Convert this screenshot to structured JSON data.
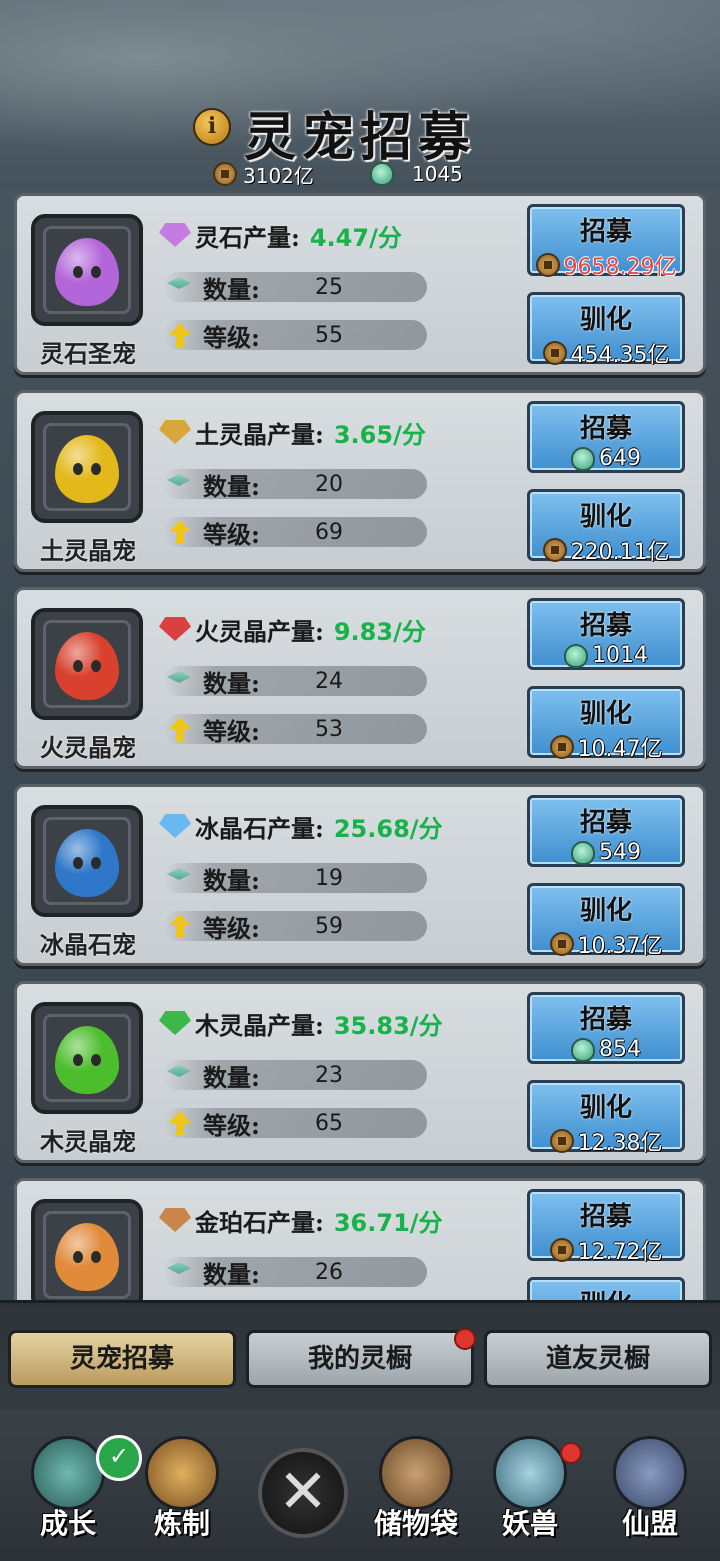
{
  "header": {
    "title": "灵宠招募",
    "info_icon": "i",
    "spirit_stone_amount": "3102亿",
    "jade_amount": "1045"
  },
  "pets": [
    {
      "name": "灵石圣宠",
      "resource_label": "灵石产量:",
      "rate": "4.47/分",
      "count_label": "数量:",
      "count": "25",
      "level_label": "等级:",
      "level": "55",
      "recruit_label": "招募",
      "recruit_cost": "9658.29亿",
      "tame_label": "驯化",
      "tame_cost": "454.35亿",
      "gem_color": "#c57be0",
      "pet_color": "#b366d9"
    },
    {
      "name": "土灵晶宠",
      "resource_label": "土灵晶产量:",
      "rate": "3.65/分",
      "count_label": "数量:",
      "count": "20",
      "level_label": "等级:",
      "level": "69",
      "recruit_label": "招募",
      "recruit_cost": "649",
      "tame_label": "驯化",
      "tame_cost": "220.11亿",
      "gem_color": "#d9a63a",
      "pet_color": "#e3b81a"
    },
    {
      "name": "火灵晶宠",
      "resource_label": "火灵晶产量:",
      "rate": "9.83/分",
      "count_label": "数量:",
      "count": "24",
      "level_label": "等级:",
      "level": "53",
      "recruit_label": "招募",
      "recruit_cost": "1014",
      "tame_label": "驯化",
      "tame_cost": "10.47亿",
      "gem_color": "#d94040",
      "pet_color": "#d9402e"
    },
    {
      "name": "冰晶石宠",
      "resource_label": "冰晶石产量:",
      "rate": "25.68/分",
      "count_label": "数量:",
      "count": "19",
      "level_label": "等级:",
      "level": "59",
      "recruit_label": "招募",
      "recruit_cost": "549",
      "tame_label": "驯化",
      "tame_cost": "10.37亿",
      "gem_color": "#69b8ef",
      "pet_color": "#2f78c9"
    },
    {
      "name": "木灵晶宠",
      "resource_label": "木灵晶产量:",
      "rate": "35.83/分",
      "count_label": "数量:",
      "count": "23",
      "level_label": "等级:",
      "level": "65",
      "recruit_label": "招募",
      "recruit_cost": "854",
      "tame_label": "驯化",
      "tame_cost": "12.38亿",
      "gem_color": "#3cb84a",
      "pet_color": "#4cbd2c"
    },
    {
      "name": "",
      "resource_label": "金珀石产量:",
      "rate": "36.71/分",
      "count_label": "数量:",
      "count": "26",
      "level_label": "",
      "level": "",
      "recruit_label": "招募",
      "recruit_cost": "12.72亿",
      "tame_label": "驯化",
      "tame_cost": "",
      "gem_color": "#c9854a",
      "pet_color": "#e08a3a"
    }
  ],
  "tabs": [
    "灵宠招募",
    "我的灵橱",
    "道友灵橱"
  ],
  "nav": [
    {
      "label": "成长",
      "icon": "growth-icon",
      "color": "#3f8f8a"
    },
    {
      "label": "炼制",
      "icon": "forge-icon",
      "color": "#b98a3a"
    },
    {
      "label": "",
      "icon": "close-icon",
      "color": "#222"
    },
    {
      "label": "储物袋",
      "icon": "bag-icon",
      "color": "#a77a4a"
    },
    {
      "label": "妖兽",
      "icon": "beast-icon",
      "color": "#6fa0b0"
    },
    {
      "label": "仙盟",
      "icon": "alliance-icon",
      "color": "#5a6a8a"
    }
  ]
}
